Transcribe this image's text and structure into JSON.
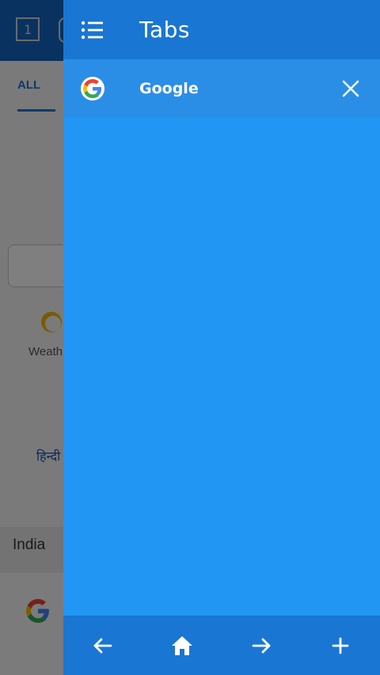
{
  "background": {
    "tab_count": "1",
    "filter_tab": "ALL",
    "weather_label": "Weath",
    "language_link": "हिन्दी",
    "region_label": "India"
  },
  "drawer": {
    "title": "Tabs",
    "tabs": [
      {
        "title": "Google",
        "favicon": "google-g-icon"
      }
    ],
    "bottom_bar": {
      "icons": [
        "back-arrow-icon",
        "home-icon",
        "forward-arrow-icon",
        "plus-icon"
      ]
    }
  },
  "colors": {
    "drawer_body": "#2196f3",
    "drawer_header": "#1976d2",
    "tab_row": "#2b8ee6",
    "text": "#ffffff"
  }
}
